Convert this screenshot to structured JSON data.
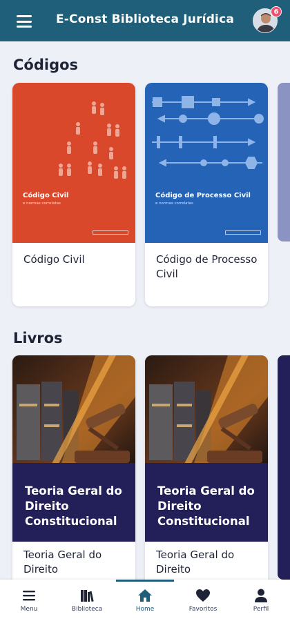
{
  "header": {
    "title": "E-Const Biblioteca Jurídica",
    "notification_count": "6"
  },
  "sections": {
    "codigos": {
      "title": "Códigos",
      "items": [
        {
          "label": "Código Civil",
          "cover_title": "Código Civil",
          "cover_subtitle": "e normas correlatas",
          "color": "#d9482b"
        },
        {
          "label": "Código de Processo Civil",
          "cover_title": "Código de Processo Civil",
          "cover_subtitle": "e normas correlatas",
          "color": "#2563b7"
        }
      ]
    },
    "livros": {
      "title": "Livros",
      "items": [
        {
          "label": "Teoria Geral do Direito",
          "cover_title": "Teoria Geral do Direito Constitucional"
        },
        {
          "label": "Teoria Geral do Direito",
          "cover_title": "Teoria Geral do Direito Constitucional"
        }
      ]
    }
  },
  "nav": {
    "items": [
      {
        "label": "Menu",
        "icon": "menu-icon"
      },
      {
        "label": "Biblioteca",
        "icon": "library-icon"
      },
      {
        "label": "Home",
        "icon": "home-icon",
        "active": true
      },
      {
        "label": "Favoritos",
        "icon": "heart-icon"
      },
      {
        "label": "Perfil",
        "icon": "person-icon"
      }
    ]
  },
  "colors": {
    "primary": "#1f5f7a",
    "badge": "#ef4f6f",
    "background": "#eef0f7"
  }
}
